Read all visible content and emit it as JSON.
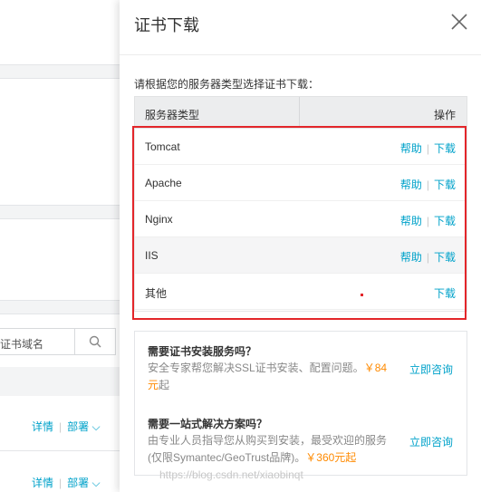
{
  "background": {
    "search_placeholder": "证书域名",
    "rows": [
      {
        "detail": "详情",
        "deploy": "部署"
      },
      {
        "detail": "详情",
        "deploy": "部署"
      }
    ]
  },
  "drawer": {
    "title": "证书下载",
    "instruction": "请根据您的服务器类型选择证书下载：",
    "table": {
      "col_type": "服务器类型",
      "col_op": "操作",
      "rows": [
        {
          "name": "Tomcat",
          "help": "帮助",
          "download": "下载"
        },
        {
          "name": "Apache",
          "help": "帮助",
          "download": "下载"
        },
        {
          "name": "Nginx",
          "help": "帮助",
          "download": "下载"
        },
        {
          "name": "IIS",
          "help": "帮助",
          "download": "下载"
        },
        {
          "name": "其他",
          "help": "",
          "download": "下载"
        }
      ]
    },
    "info": {
      "service_title": "需要证书安装服务吗？",
      "service_desc": "安全专家帮您解决SSL证书安装、配置问题。",
      "service_price": "￥84元",
      "service_desc_tail": "起",
      "service_consult": "立即咨询",
      "solution_title": "需要一站式解决方案吗？",
      "solution_desc": "由专业人员指导您从购买到安装，最受欢迎的服务(仅限Symantec/GeoTrust品牌)。",
      "solution_price": "￥360元起",
      "solution_consult": "立即咨询"
    },
    "colors": {
      "accent": "#00a2ca",
      "highlight": "#e3262a",
      "price": "#ff8a00"
    }
  },
  "watermark": "https://blog.csdn.net/xiaobinqt"
}
